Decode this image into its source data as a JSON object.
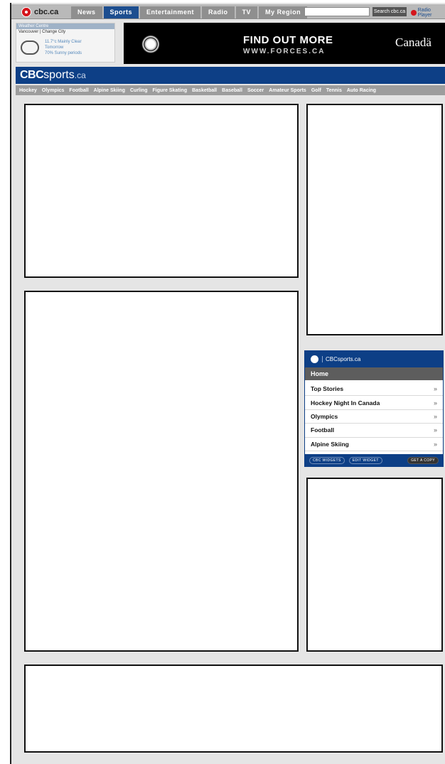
{
  "topnav": {
    "logo": "cbc.ca",
    "tabs": [
      "News",
      "Sports",
      "Entertainment",
      "Radio",
      "TV",
      "My Region"
    ],
    "active_tab": "Sports",
    "search_button": "Search cbc.ca",
    "radio_link": "Radio Player"
  },
  "weather": {
    "header": "Weather Centre",
    "city": "Vancouver | Change City",
    "condition": "11.7°c Mainly Clear",
    "tomorrow": "Tomorrow",
    "pop": "70% Sunny periods"
  },
  "ad": {
    "cta": "FIND OUT MORE",
    "url": "WWW.FORCES.CA",
    "brand": "Canadä"
  },
  "brand": {
    "prefix": "CBC",
    "name": "sports",
    "tld": ".ca"
  },
  "sport_nav": [
    "Hockey",
    "Olympics",
    "Football",
    "Alpine Skiing",
    "Curling",
    "Figure Skating",
    "Basketball",
    "Baseball",
    "Soccer",
    "Amateur Sports",
    "Golf",
    "Tennis",
    "Auto Racing"
  ],
  "widget": {
    "logo": "CBCsports.ca",
    "tab": "Home",
    "items": [
      "Top Stories",
      "Hockey Night In Canada",
      "Olympics",
      "Football",
      "Alpine Skiing"
    ],
    "chevron": "»",
    "footer_buttons": [
      "CBC WIDGETS",
      "EDIT WIDGET"
    ],
    "get_button": "GET A COPY"
  }
}
